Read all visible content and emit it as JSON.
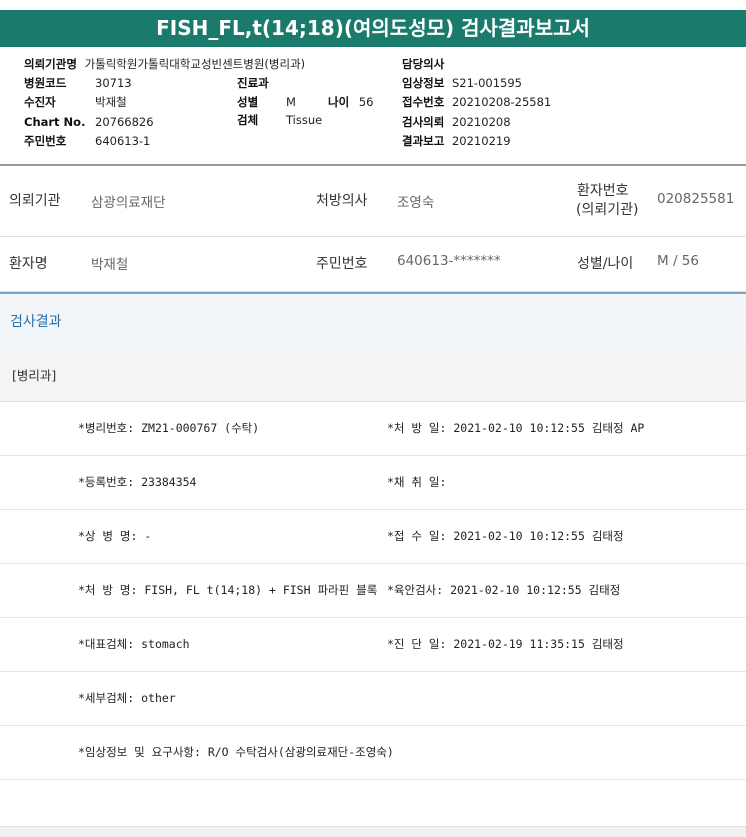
{
  "report_title": "FISH_FL,t(14;18)(여의도성모) 검사결과보고서",
  "header": {
    "institution_label": "의뢰기관명",
    "institution_value": "가톨릭학원가톨릭대학교성빈센트병원(병리과)",
    "doctor_label": "담당의사",
    "doctor_value": "",
    "hospital_code_label": "병원코드",
    "hospital_code_value": "30713",
    "dept_label": "진료과",
    "dept_value": "",
    "clinical_info_label": "임상정보",
    "clinical_info_value": "S21-001595",
    "patient_label": "수진자",
    "patient_value": "박재철",
    "sex_label": "성별",
    "sex_value": "M",
    "age_label": "나이",
    "age_value": "56",
    "receipt_no_label": "접수번호",
    "receipt_no_value": "20210208-25581",
    "chart_label": "Chart No.",
    "chart_value": "20766826",
    "specimen_label": "검체",
    "specimen_value": "Tissue",
    "request_date_label": "검사의뢰",
    "request_date_value": "20210208",
    "rrn_label": "주민번호",
    "rrn_value": "640613-1",
    "report_date_label": "결과보고",
    "report_date_value": "20210219"
  },
  "info": {
    "inst_label": "의뢰기관",
    "inst_value": "삼광의료재단",
    "presc_label": "처방의사",
    "presc_value": "조영숙",
    "pid_label_1": "환자번호",
    "pid_label_2": "(의뢰기관)",
    "pid_value": "020825581",
    "name_label": "환자명",
    "name_value": "박재철",
    "rrn_label": "주민번호",
    "rrn_value": "640613-*******",
    "sexage_label": "성별/나이",
    "sexage_value": "M / 56"
  },
  "section_title": "검사결과",
  "department": "[병리과]",
  "results": [
    {
      "left": "*병리번호: ZM21-000767 (수탁)",
      "right": "*처 방 일: 2021-02-10 10:12:55  김태정 AP"
    },
    {
      "left": "*등록번호: 23384354",
      "right": "*채 취 일:"
    },
    {
      "left": "*상 병 명: -",
      "right": "*접 수 일: 2021-02-10 10:12:55  김태정"
    },
    {
      "left": "*처 방 명: FISH, FL t(14;18) + FISH 파라핀 블록",
      "right": "*육안검사: 2021-02-10 10:12:55  김태정"
    },
    {
      "left": "*대표검체: stomach",
      "right": "*진 단 일: 2021-02-19 11:35:15  김태정"
    },
    {
      "left": "*세부검체: other",
      "right": ""
    },
    {
      "left": "*임상정보 및 요구사항: R/O 수탁검사(삼광의료재단-조영숙)",
      "right": ""
    }
  ]
}
